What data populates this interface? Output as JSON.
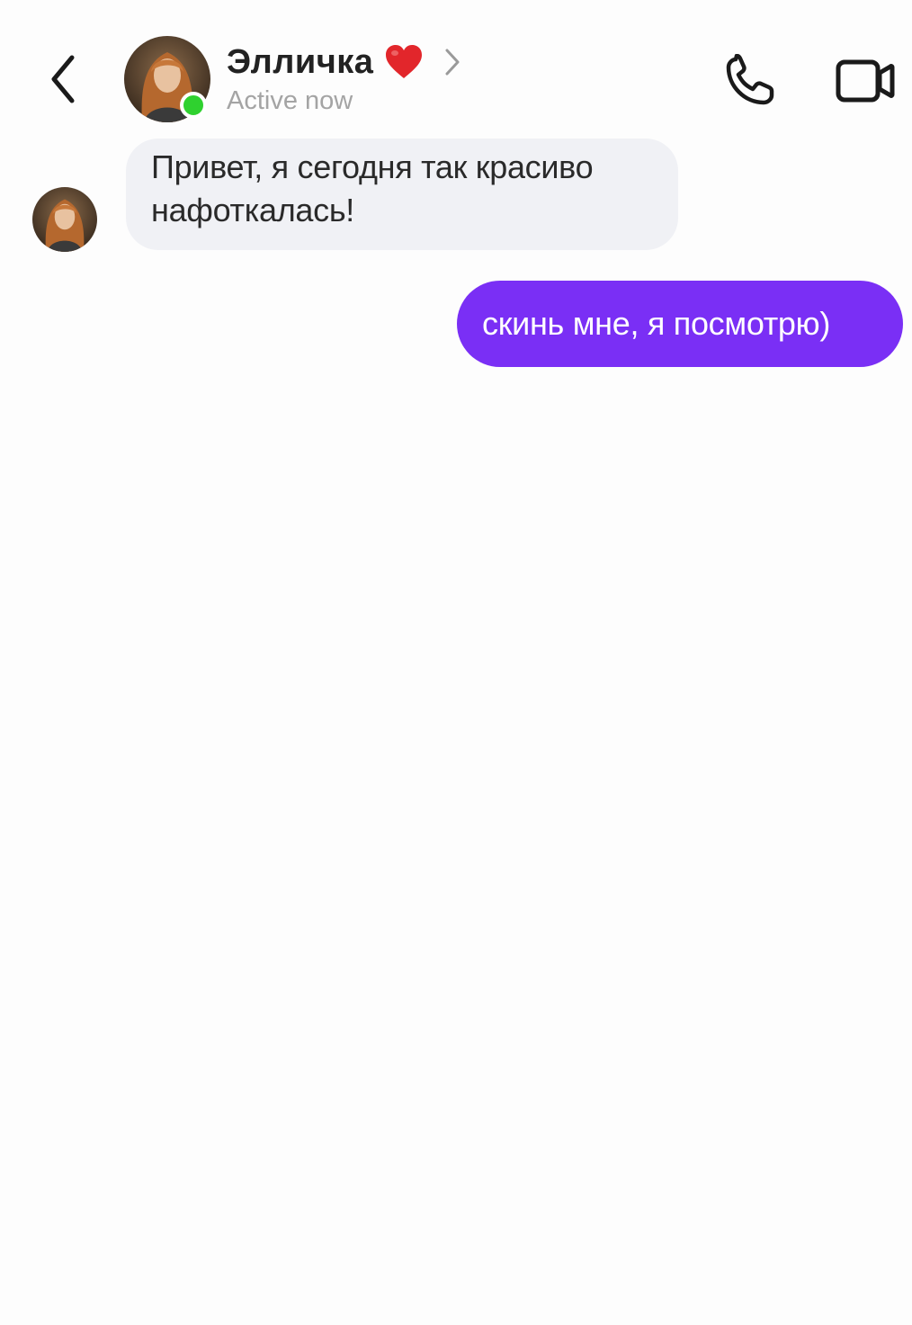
{
  "header": {
    "contact_name": "Элличка",
    "status": "Active now",
    "icons": {
      "back": "chevron-left-icon",
      "name_emoji": "heart-icon",
      "details": "chevron-right-icon",
      "call": "phone-icon",
      "video": "video-camera-icon"
    }
  },
  "messages": [
    {
      "direction": "incoming",
      "text": "Привет, я сегодня так красиво нафоткалась!"
    },
    {
      "direction": "outgoing",
      "text": "скинь мне, я посмотрю)"
    }
  ],
  "colors": {
    "outgoing_bubble": "#7a2ff5",
    "incoming_bubble": "#f0f1f5",
    "online_indicator": "#2fd12f",
    "heart": "#e2262b",
    "status_text": "#a4a4a4"
  }
}
